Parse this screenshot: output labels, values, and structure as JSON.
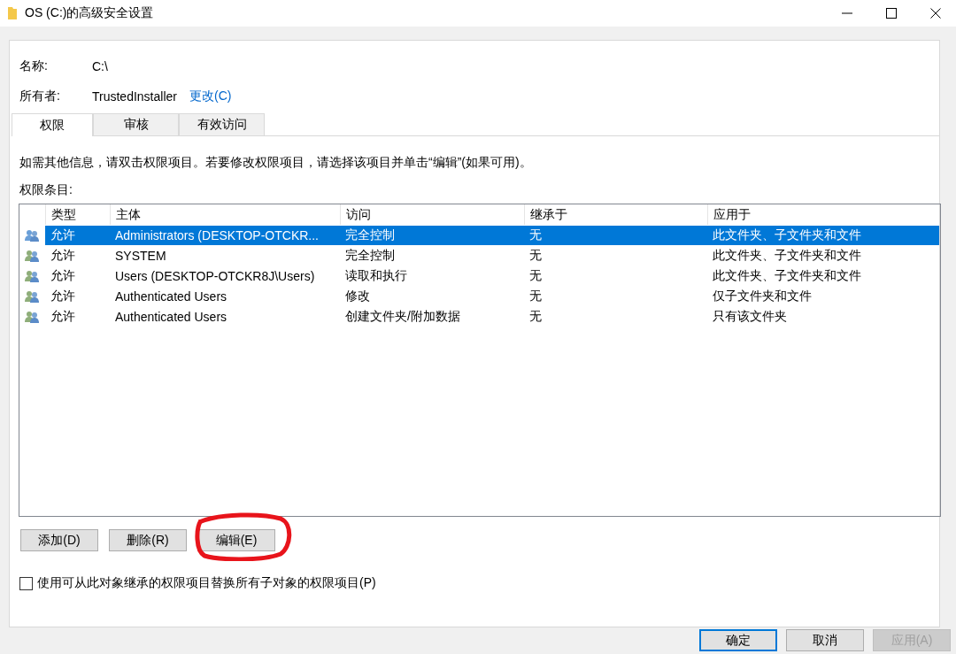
{
  "window": {
    "title": "OS (C:)的高级安全设置"
  },
  "name": {
    "label": "名称:",
    "value": "C:\\"
  },
  "owner": {
    "label": "所有者:",
    "value": "TrustedInstaller",
    "link": "更改(C)"
  },
  "tabs": [
    {
      "label": "权限",
      "selected": true
    },
    {
      "label": "审核",
      "selected": false
    },
    {
      "label": "有效访问",
      "selected": false
    }
  ],
  "instruction": "如需其他信息，请双击权限项目。若要修改权限项目，请选择该项目并单击“编辑”(如果可用)。",
  "list_label": "权限条目:",
  "table": {
    "columns": [
      "类型",
      "主体",
      "访问",
      "继承于",
      "应用于"
    ],
    "rows": [
      {
        "selected": true,
        "cells": [
          "允许",
          "Administrators (DESKTOP-OTCKR...",
          "完全控制",
          "无",
          "此文件夹、子文件夹和文件"
        ]
      },
      {
        "selected": false,
        "cells": [
          "允许",
          "SYSTEM",
          "完全控制",
          "无",
          "此文件夹、子文件夹和文件"
        ]
      },
      {
        "selected": false,
        "cells": [
          "允许",
          "Users (DESKTOP-OTCKR8J\\Users)",
          "读取和执行",
          "无",
          "此文件夹、子文件夹和文件"
        ]
      },
      {
        "selected": false,
        "cells": [
          "允许",
          "Authenticated Users",
          "修改",
          "无",
          "仅子文件夹和文件"
        ]
      },
      {
        "selected": false,
        "cells": [
          "允许",
          "Authenticated Users",
          "创建文件夹/附加数据",
          "无",
          "只有该文件夹"
        ]
      }
    ]
  },
  "actions": [
    {
      "label": "添加(D)",
      "highlighted": false
    },
    {
      "label": "删除(R)",
      "highlighted": false
    },
    {
      "label": "编辑(E)",
      "highlighted": true
    }
  ],
  "replace_checkbox": {
    "label": "使用可从此对象继承的权限项目替换所有子对象的权限项目(P)",
    "checked": false
  },
  "buttons": [
    {
      "label": "确定",
      "default": true,
      "disabled": false
    },
    {
      "label": "取消",
      "default": false,
      "disabled": false
    },
    {
      "label": "应用(A)",
      "default": false,
      "disabled": true
    }
  ]
}
